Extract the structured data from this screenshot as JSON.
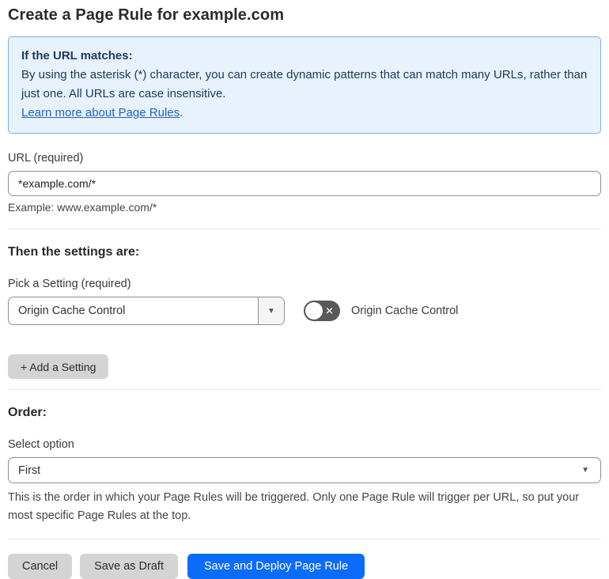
{
  "page": {
    "title": "Create a Page Rule for example.com"
  },
  "info_box": {
    "heading": "If the URL matches:",
    "body": "By using the asterisk (*) character, you can create dynamic patterns that can match many URLs, rather than just one. All URLs are case insensitive.",
    "link_label": "Learn more about Page Rules",
    "link_suffix": "."
  },
  "url_section": {
    "label": "URL (required)",
    "input_value": "*example.com/*",
    "example": "Example: www.example.com/*"
  },
  "settings_section": {
    "heading": "Then the settings are:",
    "pick_label": "Pick a Setting (required)",
    "selected_setting": "Origin Cache Control",
    "dropdown_caret": "▼",
    "toggle_state": "off",
    "toggle_glyph": "✕",
    "toggle_caption": "Origin Cache Control",
    "add_button_label": "+ Add a Setting"
  },
  "order_section": {
    "heading": "Order:",
    "label": "Select option",
    "selected_option": "First",
    "caret": "▼",
    "helper": "This is the order in which your Page Rules will be triggered. Only one Page Rule will trigger per URL, so put your most specific Page Rules at the top."
  },
  "footer": {
    "cancel_label": "Cancel",
    "save_draft_label": "Save as Draft",
    "save_deploy_label": "Save and Deploy Page Rule"
  },
  "colors": {
    "info_background": "#e8f2fc",
    "info_border": "#7fb0de",
    "info_text": "#1e3a60",
    "link": "#2362c5",
    "primary_button": "#0b6cfa",
    "secondary_button": "#d4d4d4",
    "toggle_off": "#595959",
    "divider": "#e4e4e4"
  }
}
